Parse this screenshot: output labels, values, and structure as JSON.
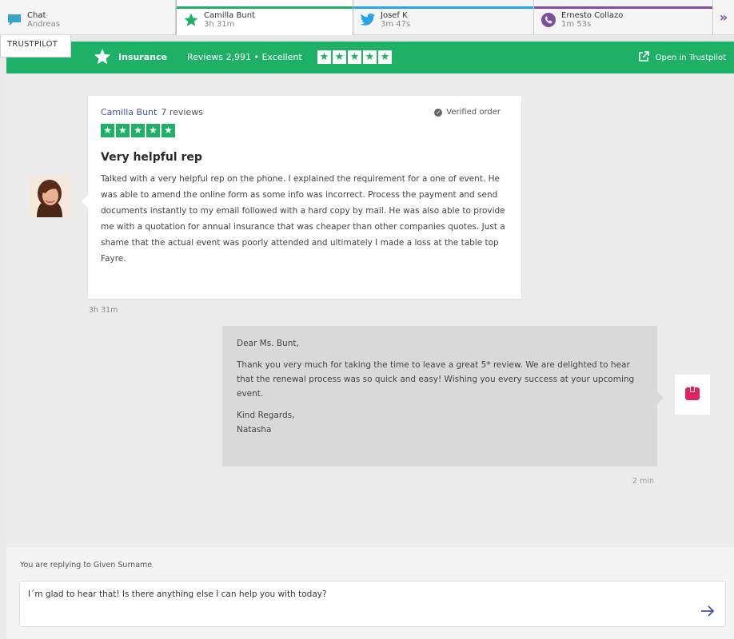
{
  "tabs": [
    {
      "name": "Chat",
      "sub": "Andreas",
      "icon": "chat-bubble-icon",
      "color": "#3aa3c9"
    },
    {
      "name": "Camilla Bunt",
      "sub": "3h 31m",
      "icon": "trustpilot-star-icon",
      "color": "#1fb067"
    },
    {
      "name": "Josef K",
      "sub": "3m 47s",
      "icon": "twitter-bird-icon",
      "color": "#2aa3ef"
    },
    {
      "name": "Ernesto Collazo",
      "sub": "1m 53s",
      "icon": "viber-icon",
      "color": "#7d4fa0"
    }
  ],
  "channel_label": "TRUSTPILOT",
  "header": {
    "category": "Insurance",
    "reviews_text": "Reviews 2,991  •  Excellent",
    "open_link": "Open in Trustpilot",
    "accent": "#1fb067"
  },
  "review": {
    "author": "Camilla Bunt",
    "review_count": "7 reviews",
    "verified": "Verified order",
    "rating": 5,
    "title": "Very helpful rep",
    "body": "Talked with a very helpful rep on the phone. I explained the requirement for a one of event. He was able to amend the online form as some info was incorrect. Process the payment and send documents instantly to my email followed with a hard copy by mail. He was also able to provide me with a quotation for annual insurance that was cheaper than other companies quotes. Just a shame that the actual event was poorly attended and ultimately I made a loss at the table top Fayre.",
    "time": "3h 31m"
  },
  "reply": {
    "greeting": "Dear Ms. Bunt,",
    "body": "Thank you very much for taking the time to leave a great 5* review. We are delighted to hear that the renewal process was so quick and easy! Wishing you every success at your upcoming event.",
    "signoff": "Kind Regards,",
    "signature": "Natasha",
    "time": "2 min",
    "brand_color": "#e0245e"
  },
  "composer": {
    "replying_to": "You are replying to Given Surname",
    "value": "I´m glad to hear that! Is there anything else I can help you with today?"
  }
}
